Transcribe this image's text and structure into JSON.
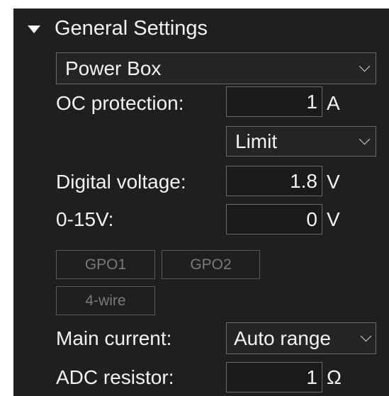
{
  "section": {
    "title": "General Settings"
  },
  "device_select": {
    "value": "Power Box"
  },
  "oc_protection": {
    "label": "OC protection:",
    "value": "1",
    "unit": "A",
    "mode": "Limit"
  },
  "digital_voltage": {
    "label": "Digital voltage:",
    "value": "1.8",
    "unit": "V"
  },
  "range_0_15v": {
    "label": "0-15V:",
    "value": "0",
    "unit": "V"
  },
  "buttons": {
    "gpo1": "GPO1",
    "gpo2": "GPO2",
    "four_wire": "4-wire"
  },
  "main_current": {
    "label": "Main current:",
    "value": "Auto range"
  },
  "adc_resistor": {
    "label": "ADC resistor:",
    "value": "1",
    "unit": "Ω"
  }
}
